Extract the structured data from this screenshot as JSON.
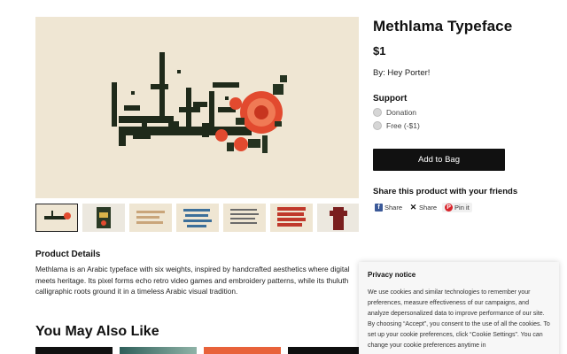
{
  "product": {
    "title": "Methlama Typeface",
    "price": "$1",
    "byline": "By: Hey Porter!",
    "image_alt": "Methlama Arabic calligraphy with pixel embroidery flowers",
    "image_lettering": "مثلما خط"
  },
  "support": {
    "label": "Support",
    "options": [
      "Donation",
      "Free (-$1)"
    ]
  },
  "add_to_bag": "Add to Bag",
  "share": {
    "title": "Share this product with your friends",
    "facebook": "Share",
    "x": "Share",
    "pinterest": "Pin it"
  },
  "details": {
    "heading": "Product Details",
    "text": "Methlama is an Arabic typeface with six weights, inspired by handcrafted aesthetics where digital meets heritage. Its pixel forms echo retro video games and embroidery patterns, while its thuluth calligraphic roots ground it in a timeless Arabic visual tradition."
  },
  "also_like": {
    "heading": "You May Also Like"
  },
  "privacy": {
    "title": "Privacy notice",
    "body": "We use cookies and similar technologies to remember your preferences, measure effectiveness of our campaigns, and analyze depersonalized data to improve performance of our site. By choosing “Accept”, you consent to the use of all the cookies. To set up your cookie preferences, click “Cookie Settings”. You can change your cookie preferences anytime in"
  },
  "colors": {
    "image_bg": "#efe6d3",
    "calligraphy": "#1f2a1a",
    "rose_red": "#e24a2f",
    "leaf_dark": "#253320",
    "button_bg": "#111111"
  },
  "icons": {
    "facebook": "facebook-icon",
    "x": "x-icon",
    "pinterest": "pinterest-icon"
  }
}
